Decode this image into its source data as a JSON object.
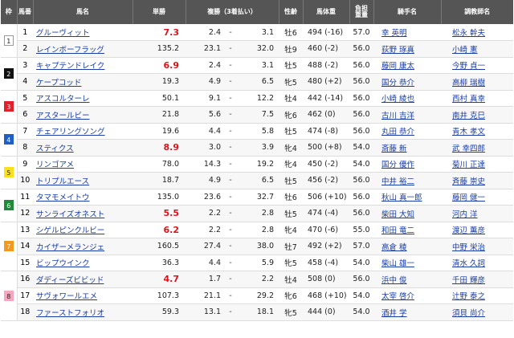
{
  "headers": {
    "waku": "枠",
    "umaban": "馬番",
    "name": "馬名",
    "win": "単勝",
    "place": "複勝（3着払い）",
    "sex_age": "性齢",
    "weight": "馬体重",
    "futan_l1": "負担",
    "futan_l2": "重量",
    "jockey": "騎手名",
    "trainer": "調教師名"
  },
  "place_separator": "-",
  "waku_colors": {
    "1": {
      "bg": "#ffffff",
      "fg": "#222222",
      "border": "#999999"
    },
    "2": {
      "bg": "#111111",
      "fg": "#ffffff",
      "border": "#111111"
    },
    "3": {
      "bg": "#e0202a",
      "fg": "#ffffff",
      "border": "#e0202a"
    },
    "4": {
      "bg": "#1f5fc4",
      "fg": "#ffffff",
      "border": "#1f5fc4"
    },
    "5": {
      "bg": "#f7e11e",
      "fg": "#222222",
      "border": "#f7e11e"
    },
    "6": {
      "bg": "#1e8a3a",
      "fg": "#ffffff",
      "border": "#1e8a3a"
    },
    "7": {
      "bg": "#f39a1e",
      "fg": "#ffffff",
      "border": "#f39a1e"
    },
    "8": {
      "bg": "#f4a7bf",
      "fg": "#222222",
      "border": "#f4a7bf"
    }
  },
  "groups": [
    {
      "waku": "1",
      "rows": [
        {
          "umaban": "1",
          "name": "グルーヴィット",
          "win": "7.3",
          "popular": true,
          "pl_min": "2.4",
          "pl_max": "3.1",
          "sex_age": "牡6",
          "weight": "494 (-16)",
          "futan": "57.0",
          "jockey": "幸 英明",
          "trainer": "松永 幹夫"
        },
        {
          "umaban": "2",
          "name": "レインボーフラッグ",
          "win": "135.2",
          "popular": false,
          "pl_min": "23.1",
          "pl_max": "32.0",
          "sex_age": "牡9",
          "weight": "460 (-2)",
          "futan": "56.0",
          "jockey": "荻野 琢真",
          "trainer": "小崎 憲"
        }
      ]
    },
    {
      "waku": "2",
      "rows": [
        {
          "umaban": "3",
          "name": "キャプテンドレイク",
          "win": "6.9",
          "popular": true,
          "pl_min": "2.4",
          "pl_max": "3.1",
          "sex_age": "牡5",
          "weight": "488 (-2)",
          "futan": "56.0",
          "jockey": "藤岡 康太",
          "trainer": "今野 貞一"
        },
        {
          "umaban": "4",
          "name": "ケープコッド",
          "win": "19.3",
          "popular": false,
          "pl_min": "4.9",
          "pl_max": "6.5",
          "sex_age": "牝5",
          "weight": "480 (+2)",
          "futan": "56.0",
          "jockey": "国分 恭介",
          "trainer": "高柳 瑞樹"
        }
      ]
    },
    {
      "waku": "3",
      "rows": [
        {
          "umaban": "5",
          "name": "アスコルターレ",
          "win": "50.1",
          "popular": false,
          "pl_min": "9.1",
          "pl_max": "12.2",
          "sex_age": "牡4",
          "weight": "442 (-14)",
          "futan": "56.0",
          "jockey": "小崎 綾也",
          "trainer": "西村 真幸"
        },
        {
          "umaban": "6",
          "name": "アスタールビー",
          "win": "21.8",
          "popular": false,
          "pl_min": "5.6",
          "pl_max": "7.5",
          "sex_age": "牝6",
          "weight": "462 (0)",
          "futan": "56.0",
          "jockey": "古川 吉洋",
          "trainer": "南井 克巳"
        }
      ]
    },
    {
      "waku": "4",
      "rows": [
        {
          "umaban": "7",
          "name": "チェアリングソング",
          "win": "19.6",
          "popular": false,
          "pl_min": "4.4",
          "pl_max": "5.8",
          "sex_age": "牡5",
          "weight": "474 (-8)",
          "futan": "56.0",
          "jockey": "丸田 恭介",
          "trainer": "青木 孝文"
        },
        {
          "umaban": "8",
          "name": "スティクス",
          "win": "8.9",
          "popular": true,
          "pl_min": "3.0",
          "pl_max": "3.9",
          "sex_age": "牝4",
          "weight": "500 (+8)",
          "futan": "54.0",
          "jockey": "斎藤 新",
          "trainer": "武 幸四郎"
        }
      ]
    },
    {
      "waku": "5",
      "rows": [
        {
          "umaban": "9",
          "name": "リンゴアメ",
          "win": "78.0",
          "popular": false,
          "pl_min": "14.3",
          "pl_max": "19.2",
          "sex_age": "牝4",
          "weight": "450 (-2)",
          "futan": "54.0",
          "jockey": "国分 優作",
          "trainer": "菊川 正達"
        },
        {
          "umaban": "10",
          "name": "トリプルエース",
          "win": "18.7",
          "popular": false,
          "pl_min": "4.9",
          "pl_max": "6.5",
          "sex_age": "牡5",
          "weight": "456 (-2)",
          "futan": "56.0",
          "jockey": "中井 裕二",
          "trainer": "斉藤 崇史"
        }
      ]
    },
    {
      "waku": "6",
      "rows": [
        {
          "umaban": "11",
          "name": "タマモメイトウ",
          "win": "135.0",
          "popular": false,
          "pl_min": "23.6",
          "pl_max": "32.7",
          "sex_age": "牡6",
          "weight": "506 (+10)",
          "futan": "56.0",
          "jockey": "秋山 真一郎",
          "trainer": "藤岡 健一"
        },
        {
          "umaban": "12",
          "name": "サンライズオネスト",
          "win": "5.5",
          "popular": true,
          "pl_min": "2.2",
          "pl_max": "2.8",
          "sex_age": "牡5",
          "weight": "474 (-4)",
          "futan": "56.0",
          "jockey": "柴田 大知",
          "trainer": "河内 洋"
        }
      ]
    },
    {
      "waku": "7",
      "rows": [
        {
          "umaban": "13",
          "name": "シゲルピンクルビー",
          "win": "6.2",
          "popular": true,
          "pl_min": "2.2",
          "pl_max": "2.8",
          "sex_age": "牝4",
          "weight": "470 (-6)",
          "futan": "55.0",
          "jockey": "和田 竜二",
          "trainer": "渡辺 薫彦"
        },
        {
          "umaban": "14",
          "name": "カイザーメランジェ",
          "win": "160.5",
          "popular": false,
          "pl_min": "27.4",
          "pl_max": "38.0",
          "sex_age": "牡7",
          "weight": "492 (+2)",
          "futan": "57.0",
          "jockey": "高倉 稜",
          "trainer": "中野 栄治"
        },
        {
          "umaban": "15",
          "name": "ビップウインク",
          "win": "36.3",
          "popular": false,
          "pl_min": "4.4",
          "pl_max": "5.9",
          "sex_age": "牝5",
          "weight": "458 (-4)",
          "futan": "54.0",
          "jockey": "柴山 雄一",
          "trainer": "清水 久詞"
        }
      ]
    },
    {
      "waku": "8",
      "rows": [
        {
          "umaban": "16",
          "name": "ダディーズビビッド",
          "win": "4.7",
          "popular": true,
          "pl_min": "1.7",
          "pl_max": "2.2",
          "sex_age": "牡4",
          "weight": "508 (0)",
          "futan": "56.0",
          "jockey": "浜中 俊",
          "trainer": "千田 輝彦"
        },
        {
          "umaban": "17",
          "name": "サヴォワールエメ",
          "win": "107.3",
          "popular": false,
          "pl_min": "21.1",
          "pl_max": "29.2",
          "sex_age": "牝6",
          "weight": "468 (+10)",
          "futan": "54.0",
          "jockey": "太宰 啓介",
          "trainer": "辻野 泰之"
        },
        {
          "umaban": "18",
          "name": "ファーストフォリオ",
          "win": "59.3",
          "popular": false,
          "pl_min": "13.1",
          "pl_max": "18.1",
          "sex_age": "牝5",
          "weight": "444 (0)",
          "futan": "54.0",
          "jockey": "酒井 学",
          "trainer": "須貝 尚介"
        }
      ]
    }
  ]
}
